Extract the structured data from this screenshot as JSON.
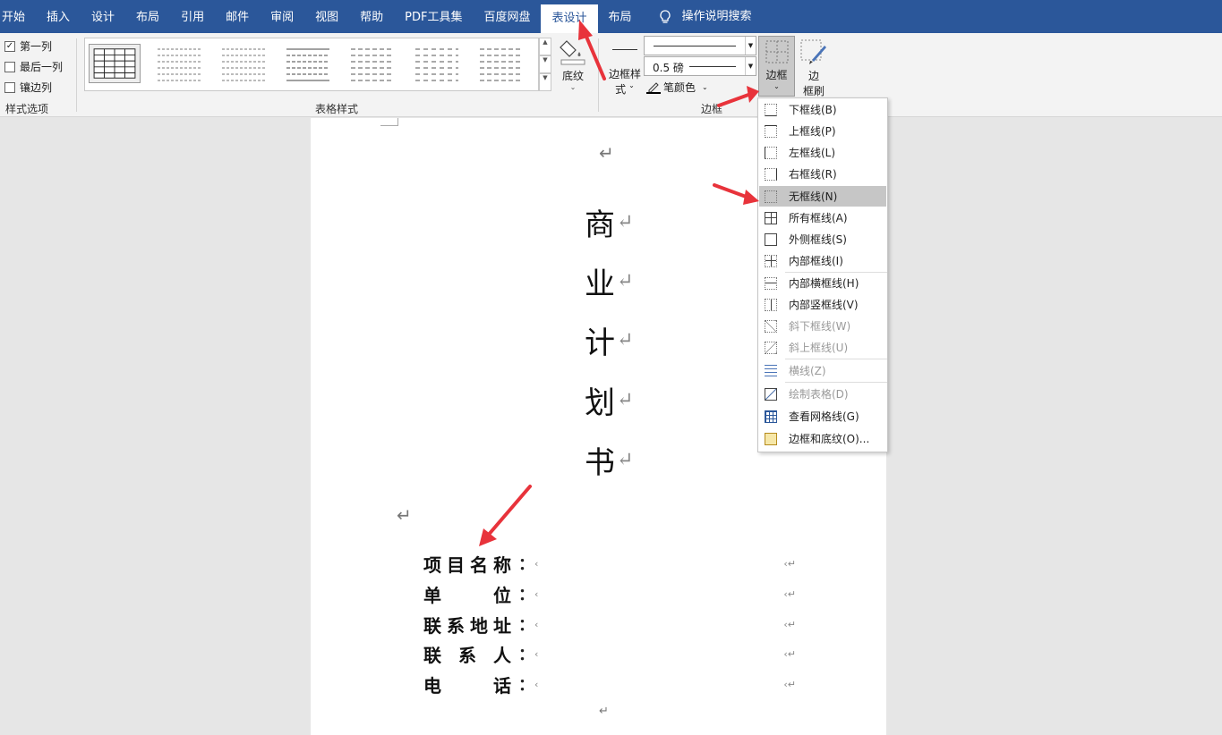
{
  "menubar": {
    "tabs": [
      "开始",
      "插入",
      "设计",
      "布局",
      "引用",
      "邮件",
      "审阅",
      "视图",
      "帮助",
      "PDF工具集",
      "百度网盘",
      "表设计",
      "布局"
    ],
    "active": "表设计",
    "search": "操作说明搜索"
  },
  "ribbon": {
    "options": {
      "first_col": "第一列",
      "last_col": "最后一列",
      "banded_col": "镶边列",
      "group": "样式选项"
    },
    "styles_group": "表格样式",
    "shading": "底纹",
    "border_styles_line1": "边框样",
    "border_styles_line2": "式",
    "pen_weight": "0.5 磅",
    "pen_color": "笔颜色",
    "borders_btn": "边框",
    "painter_line1": "边",
    "painter_line2": "框刷",
    "border_group": "边框"
  },
  "document": {
    "title_chars": [
      "商",
      "业",
      "计",
      "划",
      "书"
    ],
    "fields": [
      {
        "label_chars": [
          "项",
          "目",
          "名",
          "称"
        ]
      },
      {
        "label_chars": [
          "单",
          "位"
        ]
      },
      {
        "label_chars": [
          "联",
          "系",
          "地",
          "址"
        ]
      },
      {
        "label_chars": [
          "联",
          "系",
          "人"
        ]
      },
      {
        "label_chars": [
          "电",
          "话"
        ]
      }
    ],
    "colon": "："
  },
  "dropdown": {
    "items": [
      "下框线(B)",
      "上框线(P)",
      "左框线(L)",
      "右框线(R)",
      "无框线(N)",
      "所有框线(A)",
      "外侧框线(S)",
      "内部框线(I)",
      "内部横框线(H)",
      "内部竖框线(V)",
      "斜下框线(W)",
      "斜上框线(U)",
      "横线(Z)",
      "绘制表格(D)",
      "查看网格线(G)",
      "边框和底纹(O)..."
    ],
    "highlighted": "无框线(N)"
  },
  "colors": {
    "brand": "#2b579a",
    "arrow": "#e8333b"
  }
}
